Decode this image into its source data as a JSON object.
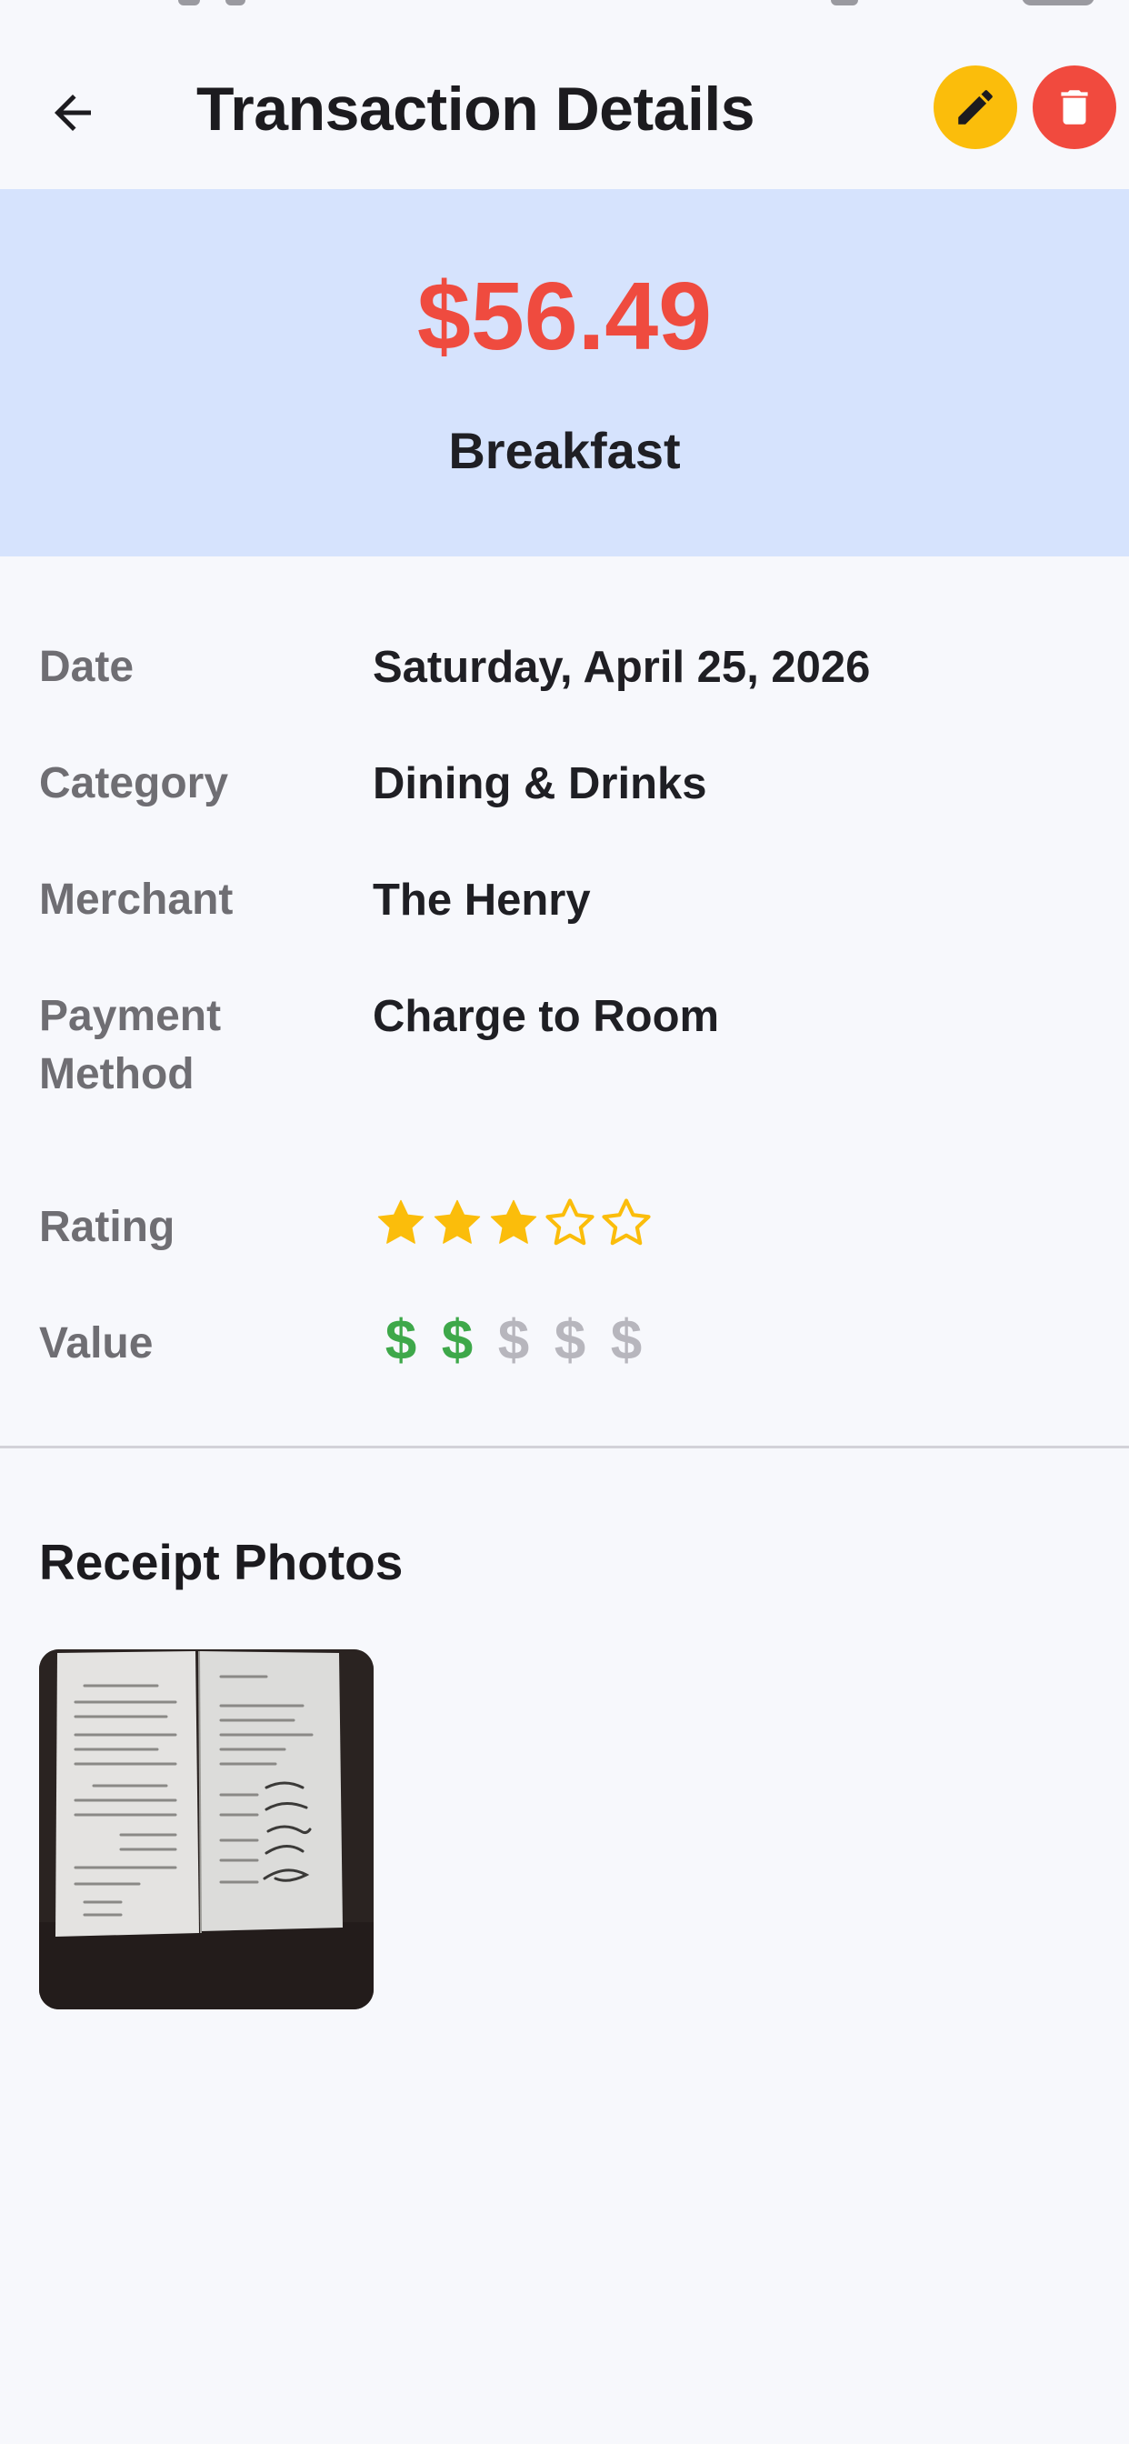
{
  "header": {
    "title": "Transaction Details",
    "back_icon": "arrow-left-icon",
    "edit_icon": "pencil-icon",
    "delete_icon": "trash-icon",
    "edit_color": "#fbbd0b",
    "delete_color": "#f14a3e"
  },
  "summary": {
    "amount": "$56.49",
    "name": "Breakfast",
    "amount_color": "#ef4b3f",
    "background": "#d6e3fd"
  },
  "details": {
    "date_label": "Date",
    "date_value": "Saturday, April 25, 2026",
    "category_label": "Category",
    "category_value": "Dining & Drinks",
    "merchant_label": "Merchant",
    "merchant_value": "The Henry",
    "payment_label_line1": "Payment",
    "payment_label_line2": "Method",
    "payment_value": "Charge to Room",
    "rating_label": "Rating",
    "rating": {
      "filled": 3,
      "max": 5,
      "color": "#fbbd0b"
    },
    "value_label": "Value",
    "value_rating": {
      "filled": 2,
      "max": 5,
      "symbol": "$",
      "filled_color": "#3ea84a",
      "empty_color": "#b7b6bd"
    }
  },
  "receipts": {
    "title": "Receipt Photos",
    "photo_count": 1
  }
}
